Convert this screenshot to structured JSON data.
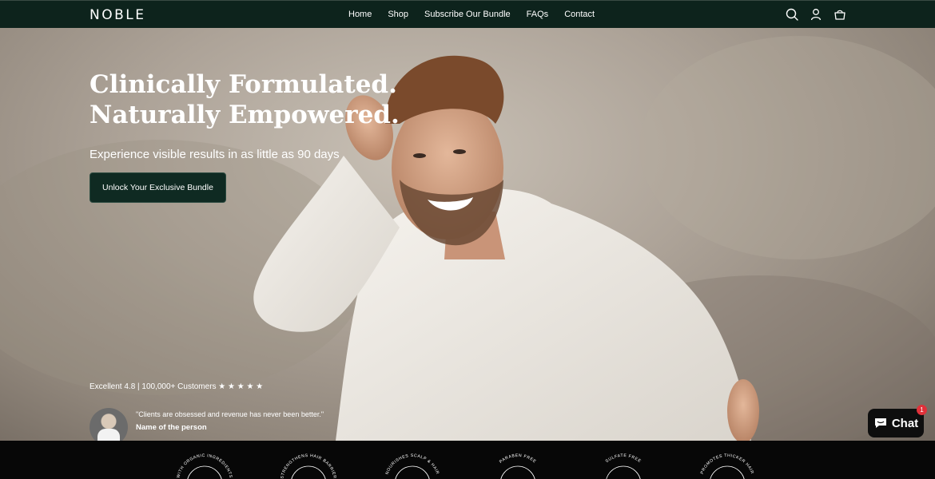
{
  "header": {
    "logo": "NOBLE",
    "nav": [
      "Home",
      "Shop",
      "Subscribe Our Bundle",
      "FAQs",
      "Contact"
    ],
    "icons": [
      "search-icon",
      "account-icon",
      "cart-icon"
    ]
  },
  "hero": {
    "title_line1": "Clinically Formulated.",
    "title_line2": "Naturally Empowered.",
    "subtitle": "Experience visible results in as little as 90 days",
    "cta": "Unlock Your Exclusive Bundle",
    "rating": "Excellent 4.8 | 100,000+ Customers ★ ★ ★ ★ ★",
    "testimonial": {
      "quote": "\"Clients are obsessed and revenue has never been better.\"",
      "name": "Name of the person"
    }
  },
  "chat": {
    "label": "Chat",
    "badge": "1"
  },
  "badges": [
    "WITH ORGANIC INGREDIENTS",
    "STRENGTHENS HAIR BARRIER",
    "NOURISHES SCALP & HAIR",
    "PARABEN FREE",
    "SULFATE FREE",
    "PROMOTES THICKER HAIR"
  ],
  "colors": {
    "header_bg": "#0d231c",
    "cta_bg": "#0f2a22",
    "strip_bg": "#070707",
    "chat_badge": "#e0313a"
  }
}
